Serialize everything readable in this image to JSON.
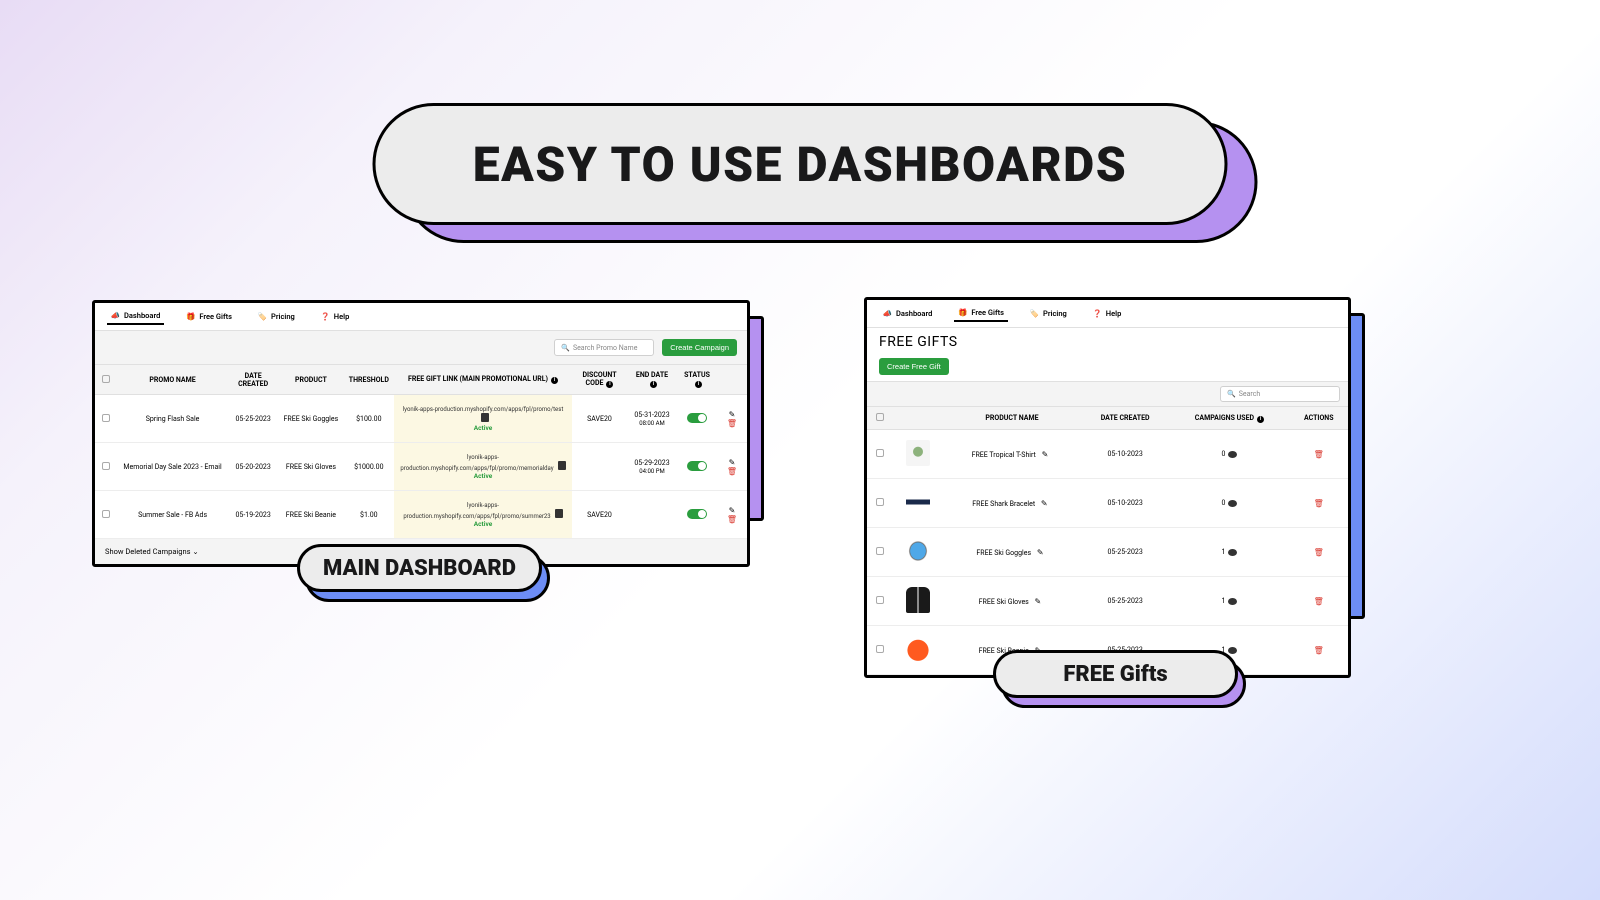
{
  "hero": {
    "title": "EASY TO USE DASHBOARDS"
  },
  "nav": {
    "dashboard": "Dashboard",
    "free_gifts": "Free Gifts",
    "pricing": "Pricing",
    "help": "Help"
  },
  "dashboard1": {
    "search_placeholder": "Search Promo Name",
    "create_button": "Create Campaign",
    "headers": {
      "promo_name": "PROMO NAME",
      "date_created": "DATE CREATED",
      "product": "PRODUCT",
      "threshold": "THRESHOLD",
      "gift_link": "FREE GIFT LINK (MAIN PROMOTIONAL URL)",
      "discount_code": "DISCOUNT CODE",
      "end_date": "END DATE",
      "status": "STATUS"
    },
    "rows": [
      {
        "name": "Spring Flash Sale",
        "date": "05-25-2023",
        "product": "FREE Ski Goggles",
        "threshold": "$100.00",
        "url": "lyonik-apps-production.myshopify.com/apps/fpl/promo/test",
        "active": "Active",
        "discount": "SAVE20",
        "end_date": "05-31-2023",
        "end_time": "08:00 AM"
      },
      {
        "name": "Memorial Day Sale 2023 - Email",
        "date": "05-20-2023",
        "product": "FREE Ski Gloves",
        "threshold": "$1000.00",
        "url": "lyonik-apps-production.myshopify.com/apps/fpl/promo/memorialday",
        "active": "Active",
        "discount": "",
        "end_date": "05-29-2023",
        "end_time": "04:00 PM"
      },
      {
        "name": "Summer Sale - FB Ads",
        "date": "05-19-2023",
        "product": "FREE Ski Beanie",
        "threshold": "$1.00",
        "url": "lyonik-apps-production.myshopify.com/apps/fpl/promo/summer23",
        "active": "Active",
        "discount": "SAVE20",
        "end_date": "",
        "end_time": ""
      }
    ],
    "show_deleted": "Show Deleted Campaigns",
    "label": "MAIN DASHBOARD"
  },
  "dashboard2": {
    "title": "FREE GIFTS",
    "create_button": "Create Free Gift",
    "search_placeholder": "Search",
    "headers": {
      "product_name": "PRODUCT NAME",
      "date_created": "DATE CREATED",
      "campaigns_used": "CAMPAIGNS USED",
      "actions": "ACTIONS"
    },
    "rows": [
      {
        "name": "FREE Tropical T-Shirt",
        "date": "05-10-2023",
        "used": "0"
      },
      {
        "name": "FREE Shark Bracelet",
        "date": "05-10-2023",
        "used": "0"
      },
      {
        "name": "FREE Ski Goggles",
        "date": "05-25-2023",
        "used": "1"
      },
      {
        "name": "FREE Ski Gloves",
        "date": "05-25-2023",
        "used": "1"
      },
      {
        "name": "FREE Ski Beanie",
        "date": "05-25-2023",
        "used": "1"
      }
    ],
    "label": "FREE Gifts"
  }
}
